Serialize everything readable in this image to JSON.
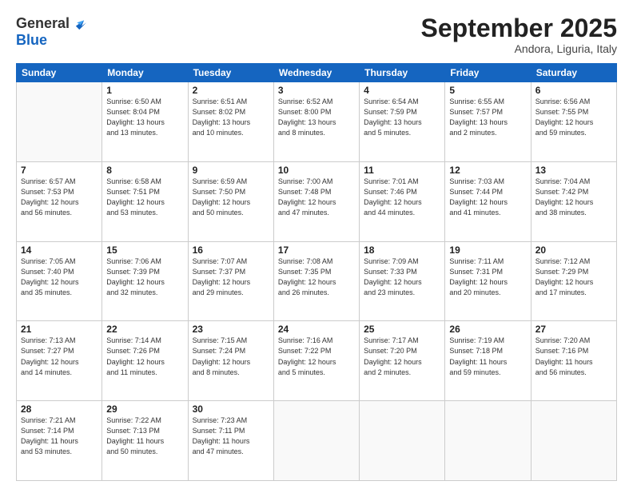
{
  "logo": {
    "general": "General",
    "blue": "Blue"
  },
  "title": "September 2025",
  "location": "Andora, Liguria, Italy",
  "weekdays": [
    "Sunday",
    "Monday",
    "Tuesday",
    "Wednesday",
    "Thursday",
    "Friday",
    "Saturday"
  ],
  "weeks": [
    [
      {
        "day": "",
        "info": ""
      },
      {
        "day": "1",
        "info": "Sunrise: 6:50 AM\nSunset: 8:04 PM\nDaylight: 13 hours\nand 13 minutes."
      },
      {
        "day": "2",
        "info": "Sunrise: 6:51 AM\nSunset: 8:02 PM\nDaylight: 13 hours\nand 10 minutes."
      },
      {
        "day": "3",
        "info": "Sunrise: 6:52 AM\nSunset: 8:00 PM\nDaylight: 13 hours\nand 8 minutes."
      },
      {
        "day": "4",
        "info": "Sunrise: 6:54 AM\nSunset: 7:59 PM\nDaylight: 13 hours\nand 5 minutes."
      },
      {
        "day": "5",
        "info": "Sunrise: 6:55 AM\nSunset: 7:57 PM\nDaylight: 13 hours\nand 2 minutes."
      },
      {
        "day": "6",
        "info": "Sunrise: 6:56 AM\nSunset: 7:55 PM\nDaylight: 12 hours\nand 59 minutes."
      }
    ],
    [
      {
        "day": "7",
        "info": "Sunrise: 6:57 AM\nSunset: 7:53 PM\nDaylight: 12 hours\nand 56 minutes."
      },
      {
        "day": "8",
        "info": "Sunrise: 6:58 AM\nSunset: 7:51 PM\nDaylight: 12 hours\nand 53 minutes."
      },
      {
        "day": "9",
        "info": "Sunrise: 6:59 AM\nSunset: 7:50 PM\nDaylight: 12 hours\nand 50 minutes."
      },
      {
        "day": "10",
        "info": "Sunrise: 7:00 AM\nSunset: 7:48 PM\nDaylight: 12 hours\nand 47 minutes."
      },
      {
        "day": "11",
        "info": "Sunrise: 7:01 AM\nSunset: 7:46 PM\nDaylight: 12 hours\nand 44 minutes."
      },
      {
        "day": "12",
        "info": "Sunrise: 7:03 AM\nSunset: 7:44 PM\nDaylight: 12 hours\nand 41 minutes."
      },
      {
        "day": "13",
        "info": "Sunrise: 7:04 AM\nSunset: 7:42 PM\nDaylight: 12 hours\nand 38 minutes."
      }
    ],
    [
      {
        "day": "14",
        "info": "Sunrise: 7:05 AM\nSunset: 7:40 PM\nDaylight: 12 hours\nand 35 minutes."
      },
      {
        "day": "15",
        "info": "Sunrise: 7:06 AM\nSunset: 7:39 PM\nDaylight: 12 hours\nand 32 minutes."
      },
      {
        "day": "16",
        "info": "Sunrise: 7:07 AM\nSunset: 7:37 PM\nDaylight: 12 hours\nand 29 minutes."
      },
      {
        "day": "17",
        "info": "Sunrise: 7:08 AM\nSunset: 7:35 PM\nDaylight: 12 hours\nand 26 minutes."
      },
      {
        "day": "18",
        "info": "Sunrise: 7:09 AM\nSunset: 7:33 PM\nDaylight: 12 hours\nand 23 minutes."
      },
      {
        "day": "19",
        "info": "Sunrise: 7:11 AM\nSunset: 7:31 PM\nDaylight: 12 hours\nand 20 minutes."
      },
      {
        "day": "20",
        "info": "Sunrise: 7:12 AM\nSunset: 7:29 PM\nDaylight: 12 hours\nand 17 minutes."
      }
    ],
    [
      {
        "day": "21",
        "info": "Sunrise: 7:13 AM\nSunset: 7:27 PM\nDaylight: 12 hours\nand 14 minutes."
      },
      {
        "day": "22",
        "info": "Sunrise: 7:14 AM\nSunset: 7:26 PM\nDaylight: 12 hours\nand 11 minutes."
      },
      {
        "day": "23",
        "info": "Sunrise: 7:15 AM\nSunset: 7:24 PM\nDaylight: 12 hours\nand 8 minutes."
      },
      {
        "day": "24",
        "info": "Sunrise: 7:16 AM\nSunset: 7:22 PM\nDaylight: 12 hours\nand 5 minutes."
      },
      {
        "day": "25",
        "info": "Sunrise: 7:17 AM\nSunset: 7:20 PM\nDaylight: 12 hours\nand 2 minutes."
      },
      {
        "day": "26",
        "info": "Sunrise: 7:19 AM\nSunset: 7:18 PM\nDaylight: 11 hours\nand 59 minutes."
      },
      {
        "day": "27",
        "info": "Sunrise: 7:20 AM\nSunset: 7:16 PM\nDaylight: 11 hours\nand 56 minutes."
      }
    ],
    [
      {
        "day": "28",
        "info": "Sunrise: 7:21 AM\nSunset: 7:14 PM\nDaylight: 11 hours\nand 53 minutes."
      },
      {
        "day": "29",
        "info": "Sunrise: 7:22 AM\nSunset: 7:13 PM\nDaylight: 11 hours\nand 50 minutes."
      },
      {
        "day": "30",
        "info": "Sunrise: 7:23 AM\nSunset: 7:11 PM\nDaylight: 11 hours\nand 47 minutes."
      },
      {
        "day": "",
        "info": ""
      },
      {
        "day": "",
        "info": ""
      },
      {
        "day": "",
        "info": ""
      },
      {
        "day": "",
        "info": ""
      }
    ]
  ]
}
